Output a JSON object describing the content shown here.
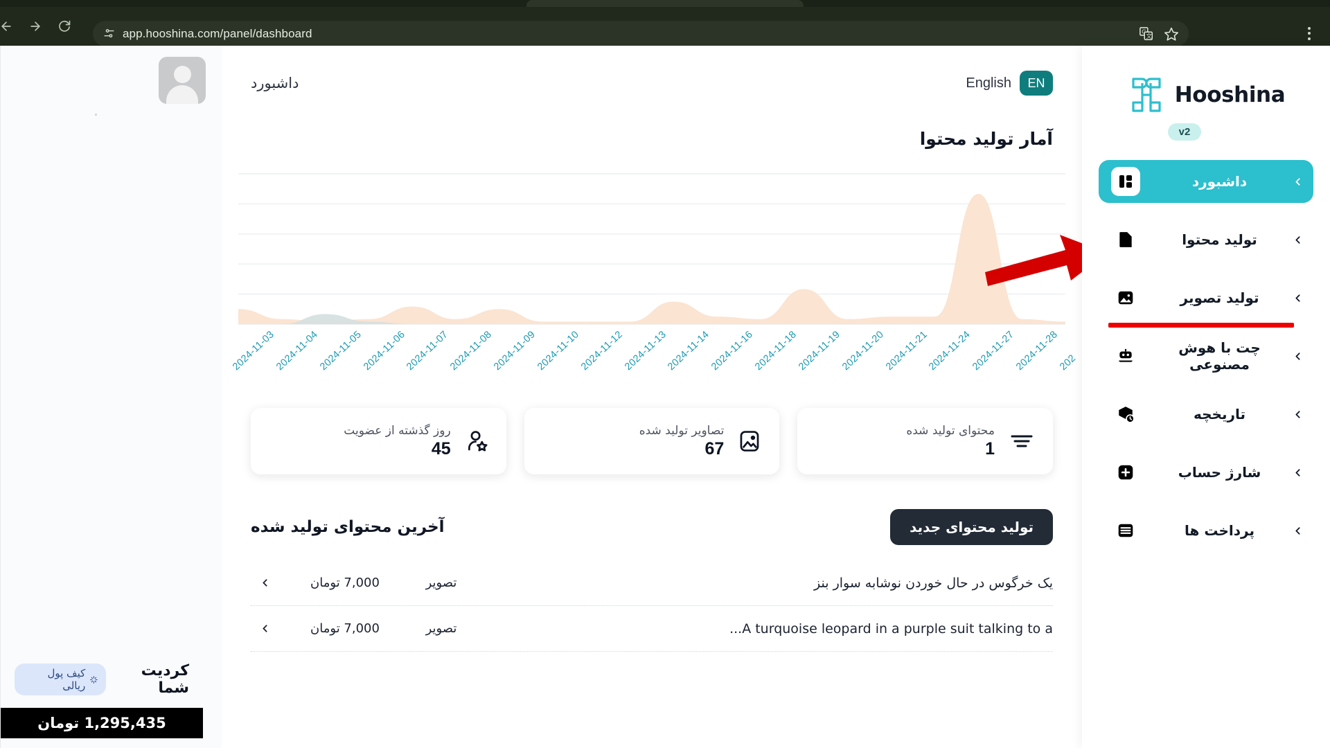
{
  "browser": {
    "url": "app.hooshina.com/panel/dashboard",
    "back_label": "Back",
    "forward_label": "Forward",
    "reload_label": "Reload",
    "site_info_label": "Site information",
    "translate_label": "Translate this page",
    "bookmark_label": "Bookmark this tab",
    "menu_label": "Customize and control Chrome"
  },
  "sidebar": {
    "brand_name": "Hooshina",
    "version": "v2",
    "items": [
      {
        "label": "داشبورد",
        "icon": "dashboard-icon",
        "active": true
      },
      {
        "label": "تولید محتوا",
        "icon": "document-icon",
        "active": false
      },
      {
        "label": "تولید تصویر",
        "icon": "image-icon",
        "active": false,
        "underlined": true
      },
      {
        "label": "چت با هوش مصنوعی",
        "icon": "robot-icon",
        "active": false
      },
      {
        "label": "تاریخچه",
        "icon": "history-icon",
        "active": false
      },
      {
        "label": "شارژ حساب",
        "icon": "plus-icon",
        "active": false
      },
      {
        "label": "پرداخت ها",
        "icon": "payments-icon",
        "active": false
      }
    ]
  },
  "header": {
    "page_title": "داشبورد",
    "language_label": "English",
    "language_code": "EN"
  },
  "chart_section": {
    "title": "آمار تولید محتوا"
  },
  "chart_data": {
    "type": "area",
    "title": "آمار تولید محتوا",
    "xlabel": "",
    "ylabel": "",
    "grid": true,
    "legend": "none",
    "ylim": [
      0,
      60
    ],
    "categories": [
      "2024-11-03",
      "2024-11-04",
      "2024-11-05",
      "2024-11-06",
      "2024-11-07",
      "2024-11-08",
      "2024-11-09",
      "2024-11-10",
      "2024-11-12",
      "2024-11-13",
      "2024-11-14",
      "2024-11-16",
      "2024-11-18",
      "2024-11-19",
      "2024-11-20",
      "2024-11-21",
      "2024-11-24",
      "2024-11-27",
      "2024-11-28",
      "202"
    ],
    "series": [
      {
        "name": "تصاویر تولید شده",
        "color": "#fbe3d0",
        "values": [
          6,
          2,
          1,
          2,
          7,
          2,
          6,
          1,
          1,
          1,
          9,
          3,
          2,
          14,
          2,
          3,
          3,
          52,
          2,
          1
        ]
      },
      {
        "name": "محتوای تولید شده",
        "color": "#d5dfe0",
        "values": [
          0,
          0,
          4,
          1,
          0,
          0,
          0,
          0,
          0,
          0,
          0,
          0,
          0,
          0,
          0,
          0,
          0,
          0,
          0,
          0
        ]
      }
    ],
    "annotation": {
      "type": "red-arrow",
      "points_to": "تولید تصویر"
    }
  },
  "stats": [
    {
      "label": "محتوای تولید شده",
      "value": "1",
      "icon": "lines-icon"
    },
    {
      "label": "تصاویر تولید شده",
      "value": "67",
      "icon": "image-frame-icon"
    },
    {
      "label": "روز گذشته از عضویت",
      "value": "45",
      "icon": "user-star-icon"
    }
  ],
  "latest": {
    "title": "آخرین محتوای تولید شده",
    "new_button": "تولید محتوای جدید",
    "rows": [
      {
        "title": "یک خرگوس در حال خوردن نوشابه سوار بنز",
        "type": "تصویر",
        "price": "7,000 تومان"
      },
      {
        "title": "A turquoise leopard in a purple suit talking to a...",
        "type": "تصویر",
        "price": "7,000 تومان"
      }
    ]
  },
  "credit": {
    "title": "کردیت شما",
    "wallet_label": "کیف پول ریالی",
    "amount": "1,295,435 تومان"
  },
  "colors": {
    "accent": "#2cbfce",
    "dark": "#121a26",
    "annotation_red": "#ee0000",
    "chart_orange": "#fbe3d0",
    "chart_teal_label": "#1c9ab2"
  }
}
